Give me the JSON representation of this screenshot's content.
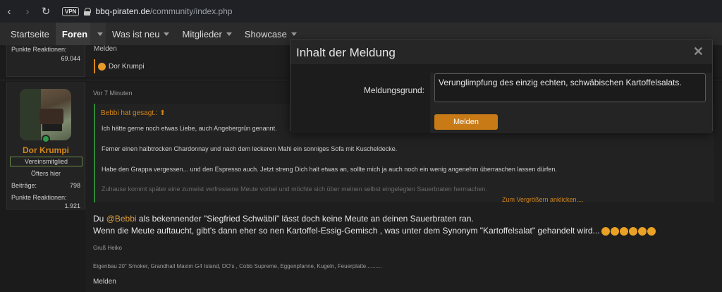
{
  "browser": {
    "vpn_label": "VPN",
    "url_host": "bbq-piraten.de",
    "url_path": "/community/index.php"
  },
  "nav": {
    "items": [
      "Startseite",
      "Foren",
      "Was ist neu",
      "Mitglieder",
      "Showcase"
    ]
  },
  "post1": {
    "reactions_label": "Punkte Reaktionen:",
    "reactions_value": "69.044",
    "report_label": "Melden",
    "reaction_user": "Dor Krumpi"
  },
  "post2": {
    "username": "Dor Krumpi",
    "role": "Vereinsmitglied",
    "activity": "Öfters hier",
    "posts_label": "Beiträge:",
    "posts_value": "798",
    "reactions_label": "Punkte Reaktionen:",
    "reactions_value": "1.921",
    "time": "Vor 7 Minuten",
    "quote_header": "Bebbi hat gesagt.:",
    "quote_lines": [
      "Ich hätte gerne noch etwas Liebe, auch Angebergrün genannt.",
      "Ferner einen halbtrocken Chardonnay und nach dem leckeren Mahl ein sonniges Sofa mit Kuscheldecke.",
      "Habe den Grappa vergessen... und den Espresso auch. Jetzt streng Dich halt etwas an, sollte mich ja auch noch ein wenig angenehm überraschen lassen dürfen.",
      "Zuhause kommt später eine zumeist verfressene Meute vorbei und möchte sich über meinen selbst eingelegten Sauerbraten hermachen."
    ],
    "expand_label": "Zum Vergrößern anklicken....",
    "body_line1_pre": "Du ",
    "body_mention": "@Bebbi",
    "body_line1_post": " als bekennender \"Siegfried Schwäbli\" lässt doch keine Meute an deinen Sauerbraten ran.",
    "body_line2": "Wenn die Meute auftaucht, gibt's dann eher so nen Kartoffel-Essig-Gemisch , was unter dem Synonym \"Kartoffelsalat\" gehandelt wird...",
    "signature_greeting": "Gruß Heiko",
    "signature_equipment": "Eigenbau 20\" Smoker, Grandhall Maxim G4 Island, DO's , Cobb Supreme, Eggenpfanne, Kugeln, Feuerplatte..........",
    "report_label": "Melden"
  },
  "modal": {
    "title": "Inhalt der Meldung",
    "field_label": "Meldungsgrund:",
    "field_value": "Verunglimpfung des einzig echten, schwäbischen Kartoffelsalats.",
    "submit_label": "Melden"
  },
  "colors": {
    "accent": "#d4861a",
    "button": "#c77a16",
    "quote_border": "#2e8a3a"
  }
}
